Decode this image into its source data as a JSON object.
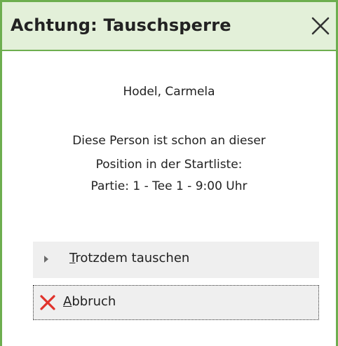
{
  "dialog": {
    "title": "Achtung: Tauschsperre",
    "close_icon": "close-icon"
  },
  "message": {
    "person": "Hodel, Carmela",
    "line1": "Diese Person ist schon an dieser",
    "line2": "Position in der Startliste:",
    "line3": "Partie: 1 - Tee  1  -  9:00  Uhr"
  },
  "buttons": {
    "swap": {
      "mnemonic": "T",
      "rest": "rotzdem tauschen",
      "icon": "triangle-right-icon"
    },
    "cancel": {
      "mnemonic": "A",
      "rest": "bbruch",
      "icon": "red-x-icon"
    }
  },
  "colors": {
    "accent_border": "#6dae4f",
    "title_background": "#e3f0d9",
    "cancel_icon": "#e0322b"
  }
}
